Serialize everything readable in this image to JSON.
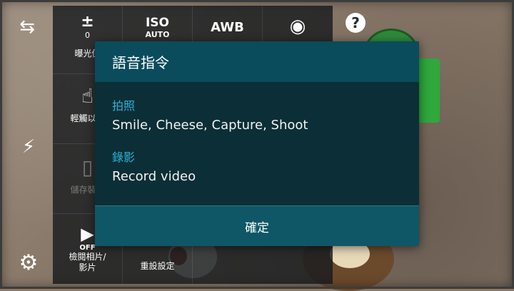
{
  "left_bar": {
    "switch_camera_icon": "⇆",
    "flash_icon": "⚡",
    "settings_icon": "⚙"
  },
  "settings_grid": {
    "cells": [
      {
        "icon": "±",
        "value": "0",
        "label": "曝光值"
      },
      {
        "icon": "ISO",
        "value": "AUTO",
        "label": ""
      },
      {
        "icon": "AWB",
        "value": "",
        "label": ""
      },
      {
        "icon": "◉",
        "value": "",
        "label": ""
      },
      {
        "icon": "☝",
        "value": "",
        "label": "輕觸以拍"
      },
      {
        "icon": "▯",
        "value": "",
        "label": "儲存裝置"
      },
      {
        "icon": "▶",
        "value": "OFF",
        "label": "檢閱相片/\n影片"
      },
      {
        "icon": "",
        "value": "",
        "label": "重設設定"
      }
    ]
  },
  "help_icon": "?",
  "dialog": {
    "title": "語音指令",
    "sections": [
      {
        "heading": "拍照",
        "text": "Smile, Cheese, Capture, Shoot"
      },
      {
        "heading": "錄影",
        "text": "Record video"
      }
    ],
    "confirm_label": "確定"
  },
  "colors": {
    "dialog_title_bg": "#0a4c5b",
    "dialog_body_bg": "#0c2e36",
    "section_heading": "#2ab3d9"
  }
}
